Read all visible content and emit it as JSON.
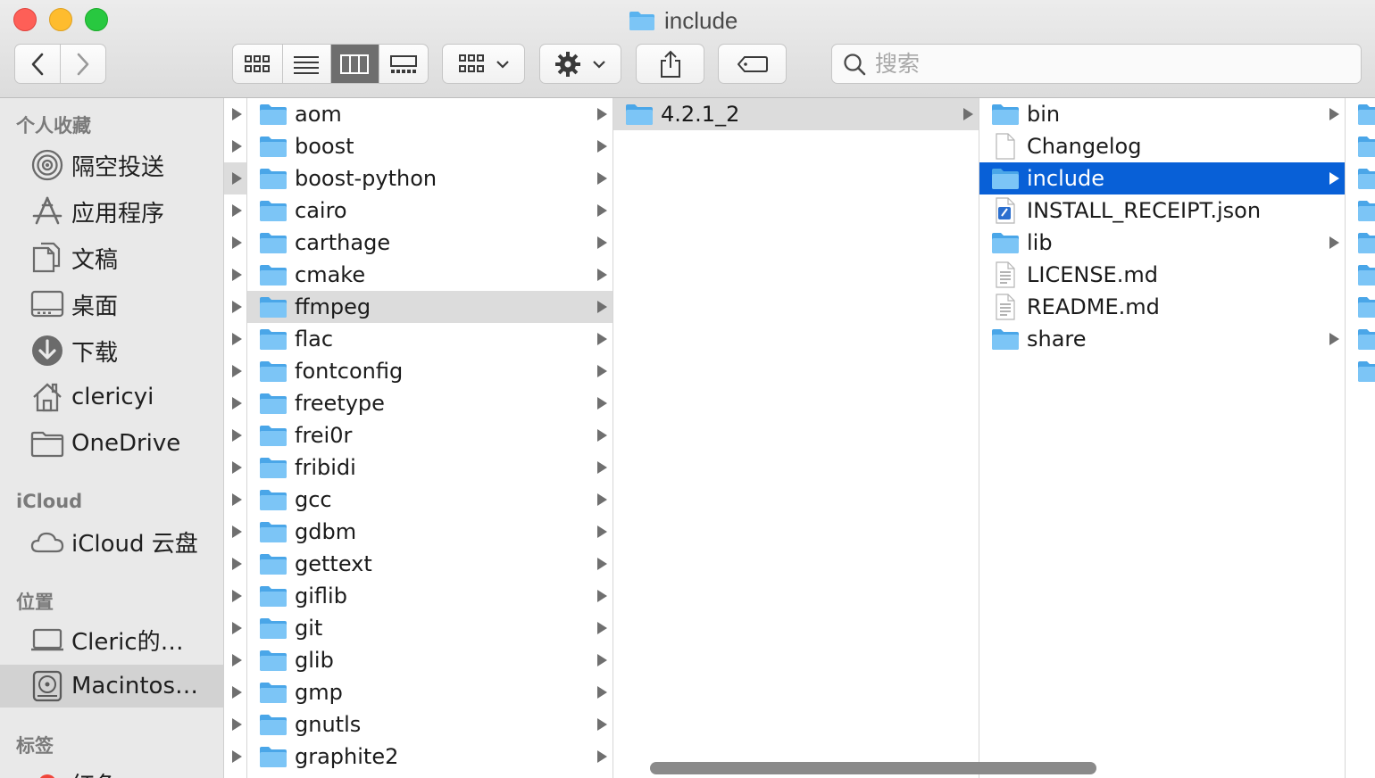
{
  "window": {
    "title": "include"
  },
  "search": {
    "placeholder": "搜索"
  },
  "sidebar": {
    "sections": [
      {
        "label": "个人收藏",
        "items": [
          {
            "label": "隔空投送",
            "icon": "airdrop-icon"
          },
          {
            "label": "应用程序",
            "icon": "applications-icon"
          },
          {
            "label": "文稿",
            "icon": "documents-icon"
          },
          {
            "label": "桌面",
            "icon": "desktop-icon"
          },
          {
            "label": "下载",
            "icon": "downloads-icon"
          },
          {
            "label": "clericyi",
            "icon": "home-icon"
          },
          {
            "label": "OneDrive",
            "icon": "folder-icon"
          }
        ]
      },
      {
        "label": "iCloud",
        "items": [
          {
            "label": "iCloud 云盘",
            "icon": "cloud-icon"
          }
        ]
      },
      {
        "label": "位置",
        "items": [
          {
            "label": "Cleric的…",
            "icon": "laptop-icon"
          },
          {
            "label": "Macintos…",
            "icon": "hard-disk-icon",
            "selected": true
          }
        ]
      },
      {
        "label": "标签",
        "items": [
          {
            "label": "红色",
            "icon": "tag-red-icon"
          }
        ]
      }
    ]
  },
  "columns": {
    "col2": [
      {
        "name": "aom"
      },
      {
        "name": "boost"
      },
      {
        "name": "boost-python"
      },
      {
        "name": "cairo"
      },
      {
        "name": "carthage"
      },
      {
        "name": "cmake"
      },
      {
        "name": "ffmpeg",
        "highlight": true
      },
      {
        "name": "flac"
      },
      {
        "name": "fontconfig"
      },
      {
        "name": "freetype"
      },
      {
        "name": "frei0r"
      },
      {
        "name": "fribidi"
      },
      {
        "name": "gcc"
      },
      {
        "name": "gdbm"
      },
      {
        "name": "gettext"
      },
      {
        "name": "giflib"
      },
      {
        "name": "git"
      },
      {
        "name": "glib"
      },
      {
        "name": "gmp"
      },
      {
        "name": "gnutls"
      },
      {
        "name": "graphite2"
      }
    ],
    "col3": [
      {
        "name": "4.2.1_2",
        "highlight": true
      }
    ],
    "col4": [
      {
        "name": "bin",
        "kind": "folder",
        "chevron": true
      },
      {
        "name": "Changelog",
        "kind": "file"
      },
      {
        "name": "include",
        "kind": "folder",
        "chevron": true,
        "selected": true
      },
      {
        "name": "INSTALL_RECEIPT.json",
        "kind": "json"
      },
      {
        "name": "lib",
        "kind": "folder",
        "chevron": true
      },
      {
        "name": "LICENSE.md",
        "kind": "text"
      },
      {
        "name": "README.md",
        "kind": "text"
      },
      {
        "name": "share",
        "kind": "folder",
        "chevron": true
      }
    ]
  },
  "colors": {
    "accent": "#0860d7",
    "folder": "#5ab3ef"
  }
}
